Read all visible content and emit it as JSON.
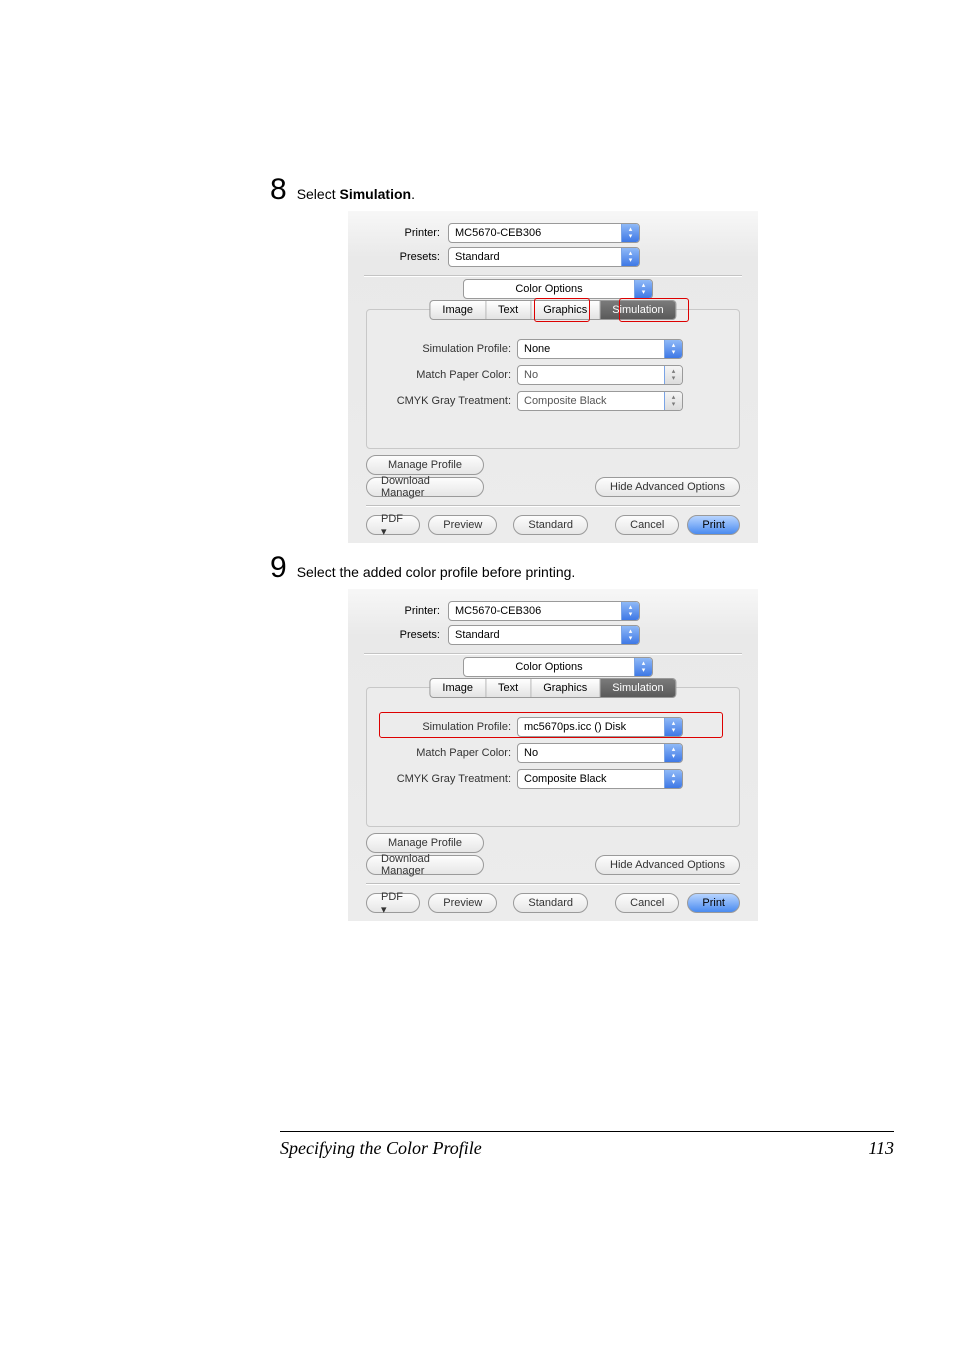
{
  "steps": {
    "s8": {
      "num": "8",
      "pre": "Select ",
      "bold": "Simulation",
      "post": "."
    },
    "s9": {
      "num": "9",
      "text": "Select the added color profile before printing."
    }
  },
  "dialog1": {
    "printerLabel": "Printer:",
    "printerValue": "MC5670-CEB306",
    "presetsLabel": "Presets:",
    "presetsValue": "Standard",
    "sectionValue": "Color Options",
    "tabs": {
      "image": "Image",
      "text": "Text",
      "graphics": "Graphics",
      "simulation": "Simulation"
    },
    "simProfileLabel": "Simulation Profile:",
    "simProfileValue": "None",
    "matchPaperLabel": "Match Paper Color:",
    "matchPaperValue": "No",
    "cmykLabel": "CMYK Gray Treatment:",
    "cmykValue": "Composite Black",
    "manageProfile": "Manage Profile",
    "downloadManager": "Download Manager",
    "hideAdvanced": "Hide Advanced Options",
    "pdf": "PDF ▾",
    "preview": "Preview",
    "standard": "Standard",
    "cancel": "Cancel",
    "print": "Print"
  },
  "dialog2": {
    "printerLabel": "Printer:",
    "printerValue": "MC5670-CEB306",
    "presetsLabel": "Presets:",
    "presetsValue": "Standard",
    "sectionValue": "Color Options",
    "tabs": {
      "image": "Image",
      "text": "Text",
      "graphics": "Graphics",
      "simulation": "Simulation"
    },
    "simProfileLabel": "Simulation Profile:",
    "simProfileValue": "mc5670ps.icc () Disk",
    "matchPaperLabel": "Match Paper Color:",
    "matchPaperValue": "No",
    "cmykLabel": "CMYK Gray Treatment:",
    "cmykValue": "Composite Black",
    "manageProfile": "Manage Profile",
    "downloadManager": "Download Manager",
    "hideAdvanced": "Hide Advanced Options",
    "pdf": "PDF ▾",
    "preview": "Preview",
    "standard": "Standard",
    "cancel": "Cancel",
    "print": "Print"
  },
  "footer": {
    "title": "Specifying the Color Profile",
    "page": "113"
  }
}
